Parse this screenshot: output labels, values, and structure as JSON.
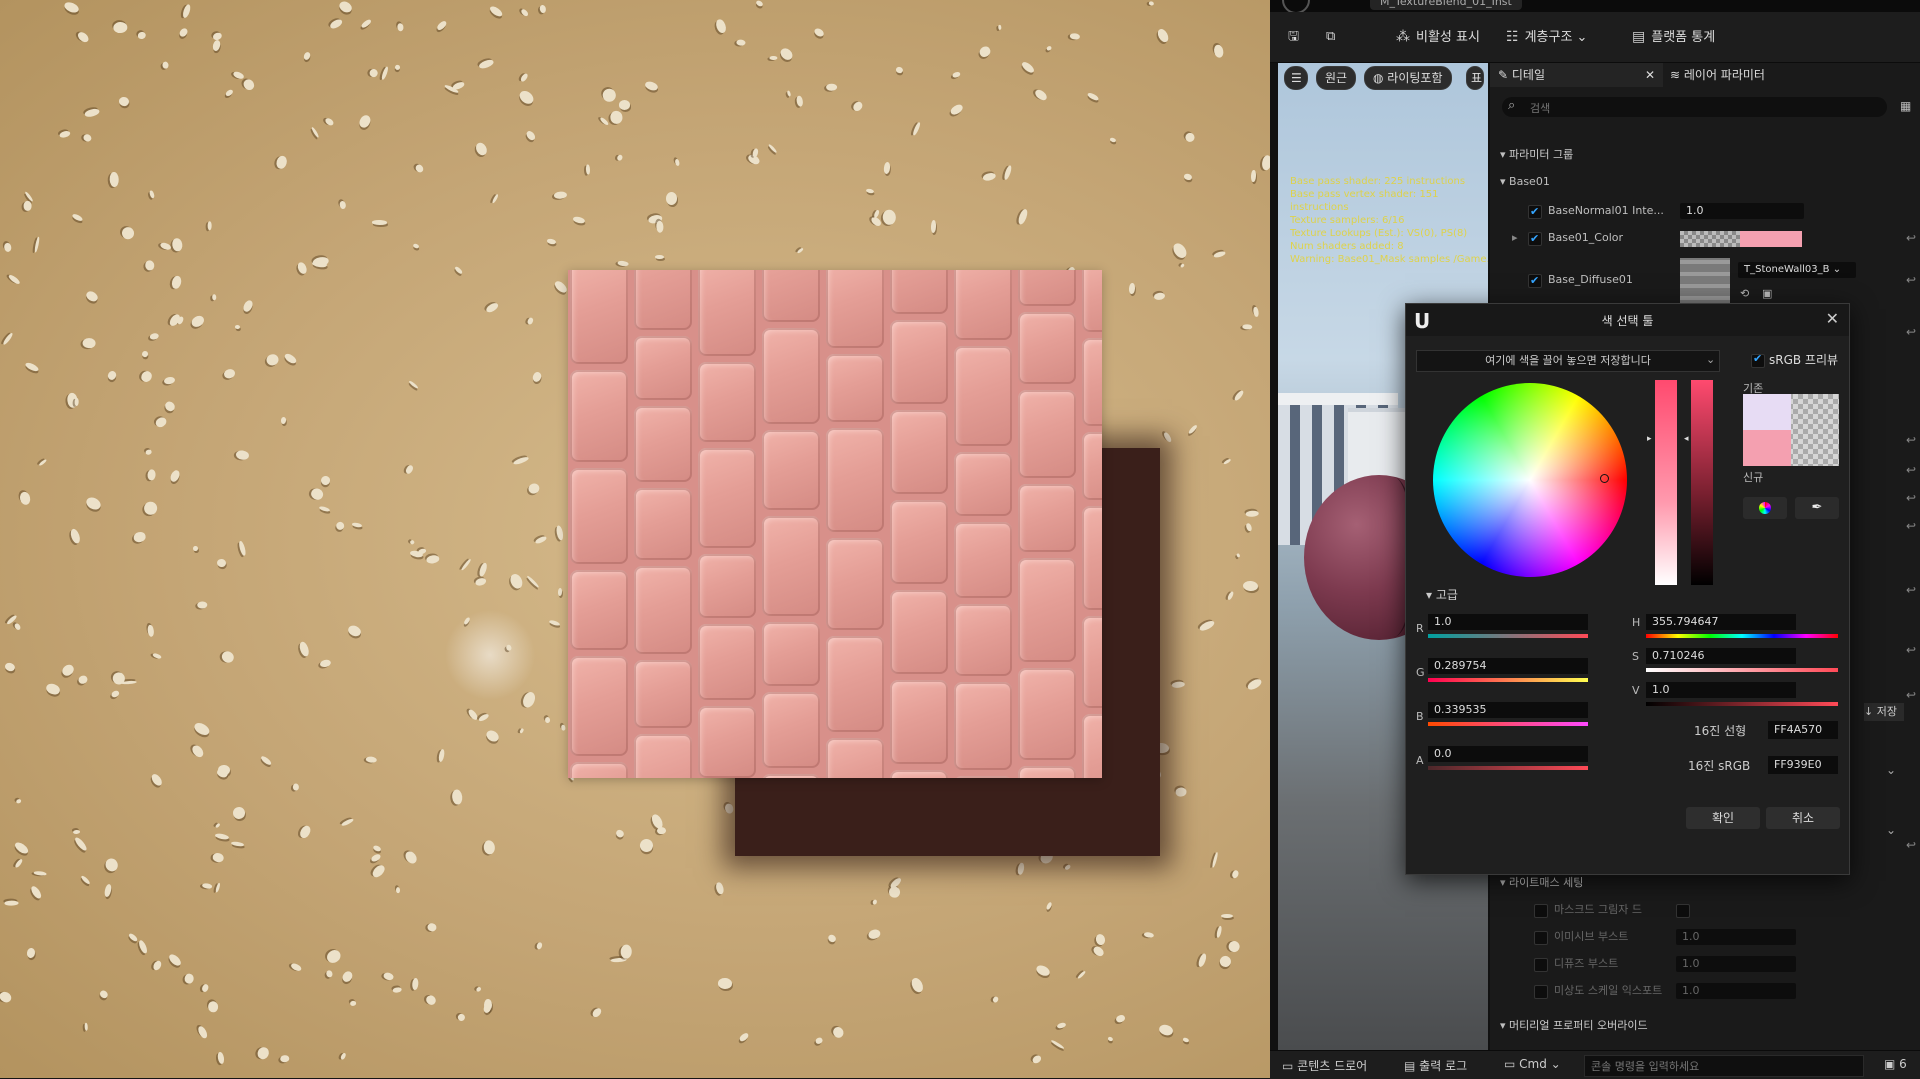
{
  "editor": {
    "doc_tab": "M_TextureBlend_01_Inst",
    "toolbar": {
      "save_icon": "save-icon",
      "browse_icon": "browse-icon",
      "hide_inactive": "비활성 표시",
      "hierarchy": "계층구조",
      "platform_stats": "플랫폼 통계"
    },
    "preview": {
      "menu_icon": "hamburger-icon",
      "perspective": "원근",
      "lit": "라이팅포함",
      "show": "표",
      "stats": [
        "Base pass shader: 225 instructions",
        "Base pass vertex shader: 151 instructions",
        "Texture samplers: 6/16",
        "Texture Lookups (Est.): VS(0), PS(8)",
        "Num shaders added: 8",
        "Warning: Base01_Mask samples /Game..."
      ]
    },
    "details": {
      "tab_details": "디테일",
      "tab_layer_params": "레이어 파라미터",
      "search_placeholder": "검색",
      "param_groups": "파라미터 그룹",
      "group_base": "Base01",
      "params": [
        {
          "name": "BaseNormal01 Inte...",
          "value": "1.0"
        },
        {
          "name": "Base01_Color",
          "value": ""
        },
        {
          "name": "Base_Diffuse01",
          "value": "T_StoneWall03_B"
        }
      ],
      "lightmass": "라이트매스 세팅",
      "lightmass_rows": [
        {
          "name": "마스크드 그림자 드",
          "value": ""
        },
        {
          "name": "이미시브 부스트",
          "value": "1.0"
        },
        {
          "name": "디퓨즈 부스트",
          "value": "1.0"
        },
        {
          "name": "미상도 스케일 익스포트",
          "value": "1.0"
        }
      ],
      "material_override": "머티리얼 프로퍼티 오버라이드",
      "save_partial": "저장"
    },
    "bottom": {
      "content_drawer": "콘텐츠 드로어",
      "output_log": "출력 로그",
      "cmd": "Cmd",
      "console_placeholder": "콘솔 명령을 입력하세요",
      "right_icon": "6"
    }
  },
  "picker": {
    "title": "색 선택 툴",
    "drop_hint": "여기에 색을 끌어 놓으면 저장합니다",
    "srgb": "sRGB 프리뷰",
    "ref_old": "기존",
    "ref_new": "신규",
    "advanced": "고급",
    "r_label": "R",
    "r": "1.0",
    "g_label": "G",
    "g": "0.289754",
    "b_label": "B",
    "b": "0.339535",
    "a_label": "A",
    "a": "0.0",
    "h_label": "H",
    "h": "355.794647",
    "s_label": "S",
    "s": "0.710246",
    "v_label": "V",
    "v": "1.0",
    "hex_linear_label": "16진 선형",
    "hex_linear": "FF4A570",
    "hex_srgb_label": "16진 sRGB",
    "hex_srgb": "FF939E0",
    "ok": "확인",
    "cancel": "취소",
    "colors": {
      "new": "#f4a0b0",
      "old": "#e7dcf4",
      "accent": "#ff4a6f"
    }
  }
}
